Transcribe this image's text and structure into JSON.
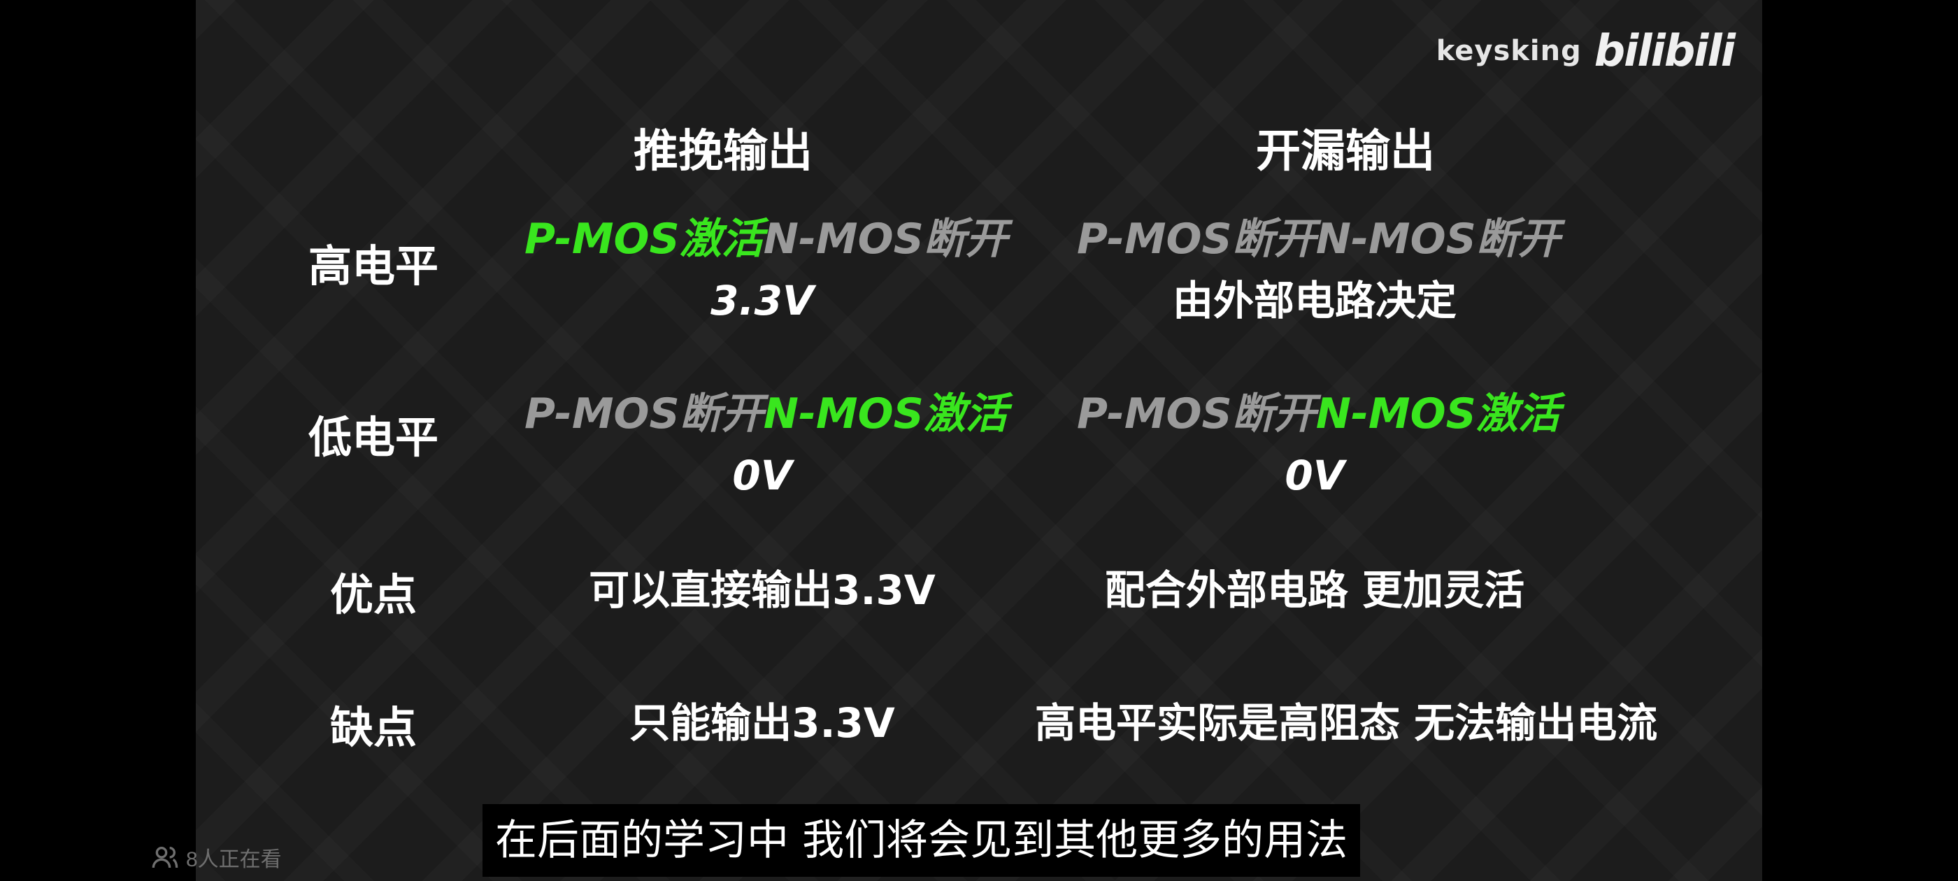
{
  "brand": {
    "uploader": "keysking",
    "logo_text": "bilibili"
  },
  "table": {
    "columns": [
      "推挽输出",
      "开漏输出"
    ],
    "rows": [
      {
        "label": "高电平",
        "push_pull": {
          "p_mos": "P-MOS激活",
          "n_mos": "N-MOS断开",
          "result": "3.3V"
        },
        "open_drain": {
          "p_mos": "P-MOS断开",
          "n_mos": "N-MOS断开",
          "result": "由外部电路决定"
        }
      },
      {
        "label": "低电平",
        "push_pull": {
          "p_mos": "P-MOS断开",
          "n_mos": "N-MOS激活",
          "result": "0V"
        },
        "open_drain": {
          "p_mos": "P-MOS断开",
          "n_mos": "N-MOS激活",
          "result": "0V"
        }
      },
      {
        "label": "优点",
        "push_pull": "可以直接输出3.3V",
        "open_drain": "配合外部电路 更加灵活"
      },
      {
        "label": "缺点",
        "push_pull": "只能输出3.3V",
        "open_drain": "高电平实际是高阻态 无法输出电流"
      }
    ]
  },
  "colors": {
    "active": "#39e61e",
    "inactive": "#9a9a9a",
    "text": "#ffffff",
    "background": "#1c1c1c"
  },
  "subtitle": "在后面的学习中 我们将会见到其他更多的用法",
  "viewers": {
    "icon": "people-icon",
    "text": "8人正在看"
  }
}
